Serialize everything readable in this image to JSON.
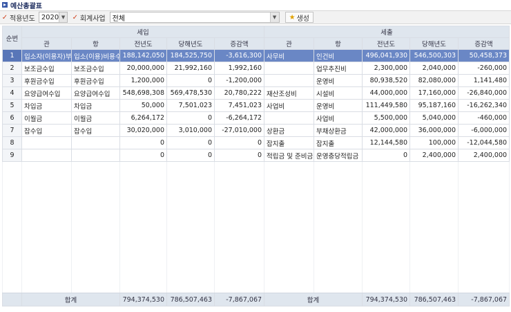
{
  "page": {
    "title": "예산총괄표"
  },
  "filters": {
    "year_label": "적용년도",
    "year_value": "2020",
    "business_label": "회계사업",
    "business_value": "전체",
    "generate_label": "생성"
  },
  "grid": {
    "headers": {
      "seq": "순번",
      "income_group": "세입",
      "expense_group": "세출",
      "gwan": "관",
      "hang": "항",
      "prev_year": "전년도",
      "curr_year": "당해년도",
      "change": "증감액"
    },
    "rows": [
      {
        "seq": "1",
        "in_gwan": "입소자(이용자)부담금",
        "in_hang": "입소(이용)비용수입",
        "in_prev": "188,142,050",
        "in_curr": "184,525,750",
        "in_diff": "-3,616,300",
        "out_gwan": "사무비",
        "out_hang": "인건비",
        "out_prev": "496,041,930",
        "out_curr": "546,500,303",
        "out_diff": "50,458,373"
      },
      {
        "seq": "2",
        "in_gwan": "보조금수입",
        "in_hang": "보조금수입",
        "in_prev": "20,000,000",
        "in_curr": "21,992,160",
        "in_diff": "1,992,160",
        "out_gwan": "",
        "out_hang": "업무추진비",
        "out_prev": "2,300,000",
        "out_curr": "2,040,000",
        "out_diff": "-260,000"
      },
      {
        "seq": "3",
        "in_gwan": "후원금수입",
        "in_hang": "후원금수입",
        "in_prev": "1,200,000",
        "in_curr": "0",
        "in_diff": "-1,200,000",
        "out_gwan": "",
        "out_hang": "운영비",
        "out_prev": "80,938,520",
        "out_curr": "82,080,000",
        "out_diff": "1,141,480"
      },
      {
        "seq": "4",
        "in_gwan": "요양급여수입",
        "in_hang": "요양급여수입",
        "in_prev": "548,698,308",
        "in_curr": "569,478,530",
        "in_diff": "20,780,222",
        "out_gwan": "재산조성비",
        "out_hang": "시설비",
        "out_prev": "44,000,000",
        "out_curr": "17,160,000",
        "out_diff": "-26,840,000"
      },
      {
        "seq": "5",
        "in_gwan": "차입금",
        "in_hang": "차입금",
        "in_prev": "50,000",
        "in_curr": "7,501,023",
        "in_diff": "7,451,023",
        "out_gwan": "사업비",
        "out_hang": "운영비",
        "out_prev": "111,449,580",
        "out_curr": "95,187,160",
        "out_diff": "-16,262,340"
      },
      {
        "seq": "6",
        "in_gwan": "이월금",
        "in_hang": "이월금",
        "in_prev": "6,264,172",
        "in_curr": "0",
        "in_diff": "-6,264,172",
        "out_gwan": "",
        "out_hang": "사업비",
        "out_prev": "5,500,000",
        "out_curr": "5,040,000",
        "out_diff": "-460,000"
      },
      {
        "seq": "7",
        "in_gwan": "잡수입",
        "in_hang": "잡수입",
        "in_prev": "30,020,000",
        "in_curr": "3,010,000",
        "in_diff": "-27,010,000",
        "out_gwan": "상환금",
        "out_hang": "부채상환금",
        "out_prev": "42,000,000",
        "out_curr": "36,000,000",
        "out_diff": "-6,000,000"
      },
      {
        "seq": "8",
        "in_gwan": "",
        "in_hang": "",
        "in_prev": "0",
        "in_curr": "0",
        "in_diff": "0",
        "out_gwan": "잡지출",
        "out_hang": "잡지출",
        "out_prev": "12,144,580",
        "out_curr": "100,000",
        "out_diff": "-12,044,580"
      },
      {
        "seq": "9",
        "in_gwan": "",
        "in_hang": "",
        "in_prev": "0",
        "in_curr": "0",
        "in_diff": "0",
        "out_gwan": "적립금 및 준비금",
        "out_hang": "운영충당적립금",
        "out_prev": "0",
        "out_curr": "2,400,000",
        "out_diff": "2,400,000"
      }
    ],
    "totals": {
      "in_label": "합계",
      "in_prev": "794,374,530",
      "in_curr": "786,507,463",
      "in_diff": "-7,867,067",
      "out_label": "합계",
      "out_prev": "794,374,530",
      "out_curr": "786,507,463",
      "out_diff": "-7,867,067"
    }
  }
}
